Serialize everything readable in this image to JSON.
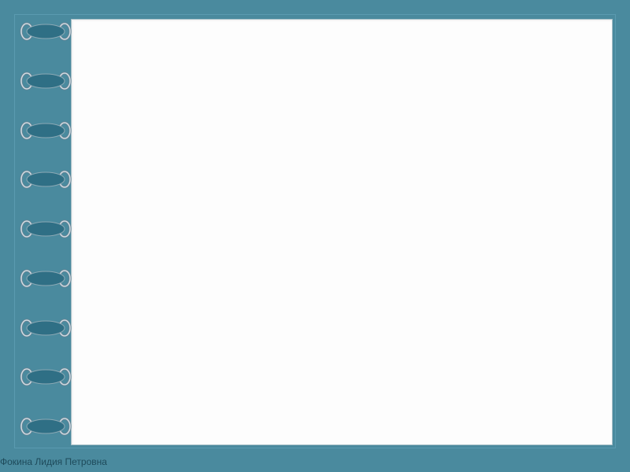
{
  "document": {
    "footer_author": "Фокина Лидия Петровна"
  },
  "binding": {
    "ring_count": 9,
    "colors": {
      "tab_fill": "#2f6f85",
      "tab_stroke": "#a8b8c0",
      "ring_metal": "#b8c8d0",
      "ring_shadow": "#6a8090"
    }
  }
}
